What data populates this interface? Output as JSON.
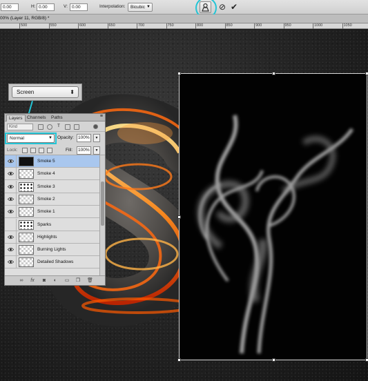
{
  "options_bar": {
    "x_value": "0.00",
    "h_label": "H:",
    "h_value": "0.00",
    "v_label": "V:",
    "v_value": "0.00",
    "interpolation_label": "Interpolation:",
    "interpolation_value": "Bicubic"
  },
  "document": {
    "tab_label": "00% (Layer 11, RGB/8) *"
  },
  "ruler": {
    "ticks": [
      "500",
      "550",
      "600",
      "650",
      "700",
      "750",
      "800",
      "850",
      "900",
      "950",
      "1000",
      "1050"
    ]
  },
  "callout": {
    "blend_mode": "Screen"
  },
  "layers_panel": {
    "tabs": [
      "Layers",
      "Channels",
      "Paths"
    ],
    "kind": "Kind",
    "blend_mode": "Normal",
    "opacity_label": "Opacity:",
    "opacity_value": "100%",
    "lock_label": "Lock:",
    "fill_label": "Fill:",
    "fill_value": "100%",
    "layers": [
      {
        "name": "Smoke 5",
        "visible": true,
        "selected": true,
        "thumb": "dark"
      },
      {
        "name": "Smoke 4",
        "visible": true,
        "selected": false,
        "thumb": "trans"
      },
      {
        "name": "Smoke 3",
        "visible": true,
        "selected": false,
        "thumb": "speck"
      },
      {
        "name": "Smoke 2",
        "visible": true,
        "selected": false,
        "thumb": "trans"
      },
      {
        "name": "Smoke 1",
        "visible": true,
        "selected": false,
        "thumb": "trans"
      },
      {
        "name": "Sparks",
        "visible": false,
        "selected": false,
        "thumb": "speck"
      },
      {
        "name": "Highlights",
        "visible": true,
        "selected": false,
        "thumb": "trans"
      },
      {
        "name": "Burning Lights",
        "visible": true,
        "selected": false,
        "thumb": "trans"
      },
      {
        "name": "Detailed Shadows",
        "visible": true,
        "selected": false,
        "thumb": "trans"
      }
    ]
  },
  "colors": {
    "highlight": "#23c5d6",
    "selected_row": "#a9c7ee"
  }
}
